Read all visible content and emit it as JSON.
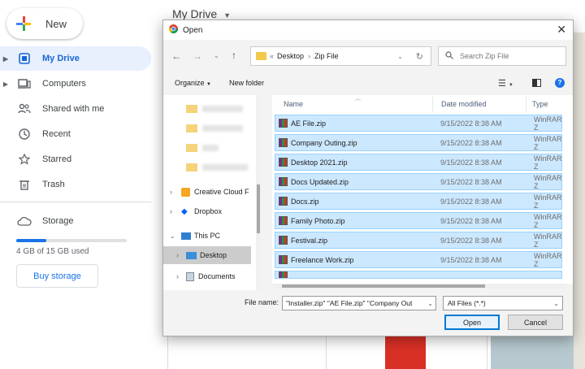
{
  "drive": {
    "new_label": "New",
    "title": "My Drive",
    "nav": [
      {
        "label": "My Drive",
        "icon": "drive-icon"
      },
      {
        "label": "Computers",
        "icon": "computer-icon"
      },
      {
        "label": "Shared with me",
        "icon": "people-icon"
      },
      {
        "label": "Recent",
        "icon": "clock-icon"
      },
      {
        "label": "Starred",
        "icon": "star-icon"
      },
      {
        "label": "Trash",
        "icon": "trash-icon"
      },
      {
        "label": "Storage",
        "icon": "cloud-icon"
      }
    ],
    "storage_used": "4 GB of 15 GB used",
    "storage_fraction": 0.27,
    "buy_storage": "Buy storage"
  },
  "dialog": {
    "title": "Open",
    "path": [
      "Desktop",
      "Zip File"
    ],
    "search_placeholder": "Search Zip File",
    "organize": "Organize",
    "new_folder": "New folder",
    "nav_items": [
      "Creative Cloud F",
      "Dropbox",
      "This PC",
      "Desktop",
      "Documents"
    ],
    "columns": [
      "Name",
      "Date modified",
      "Type"
    ],
    "files": [
      {
        "name": "AE File.zip",
        "date": "9/15/2022 8:38 AM",
        "type": "WinRAR Z"
      },
      {
        "name": "Company Outing.zip",
        "date": "9/15/2022 8:38 AM",
        "type": "WinRAR Z"
      },
      {
        "name": "Desktop 2021.zip",
        "date": "9/15/2022 8:38 AM",
        "type": "WinRAR Z"
      },
      {
        "name": "Docs Updated.zip",
        "date": "9/15/2022 8:38 AM",
        "type": "WinRAR Z"
      },
      {
        "name": "Docs.zip",
        "date": "9/15/2022 8:38 AM",
        "type": "WinRAR Z"
      },
      {
        "name": "Family Photo.zip",
        "date": "9/15/2022 8:38 AM",
        "type": "WinRAR Z"
      },
      {
        "name": "Festival.zip",
        "date": "9/15/2022 8:38 AM",
        "type": "WinRAR Z"
      },
      {
        "name": "Freelance Work.zip",
        "date": "9/15/2022 8:38 AM",
        "type": "WinRAR Z"
      }
    ],
    "file_name_label": "File name:",
    "file_name_value": "\"Installer.zip\" \"AE File.zip\" \"Company Out",
    "file_type": "All Files (*.*)",
    "open": "Open",
    "cancel": "Cancel"
  },
  "colors": {
    "accent": "#1a73e8",
    "selection": "#cce8ff"
  }
}
